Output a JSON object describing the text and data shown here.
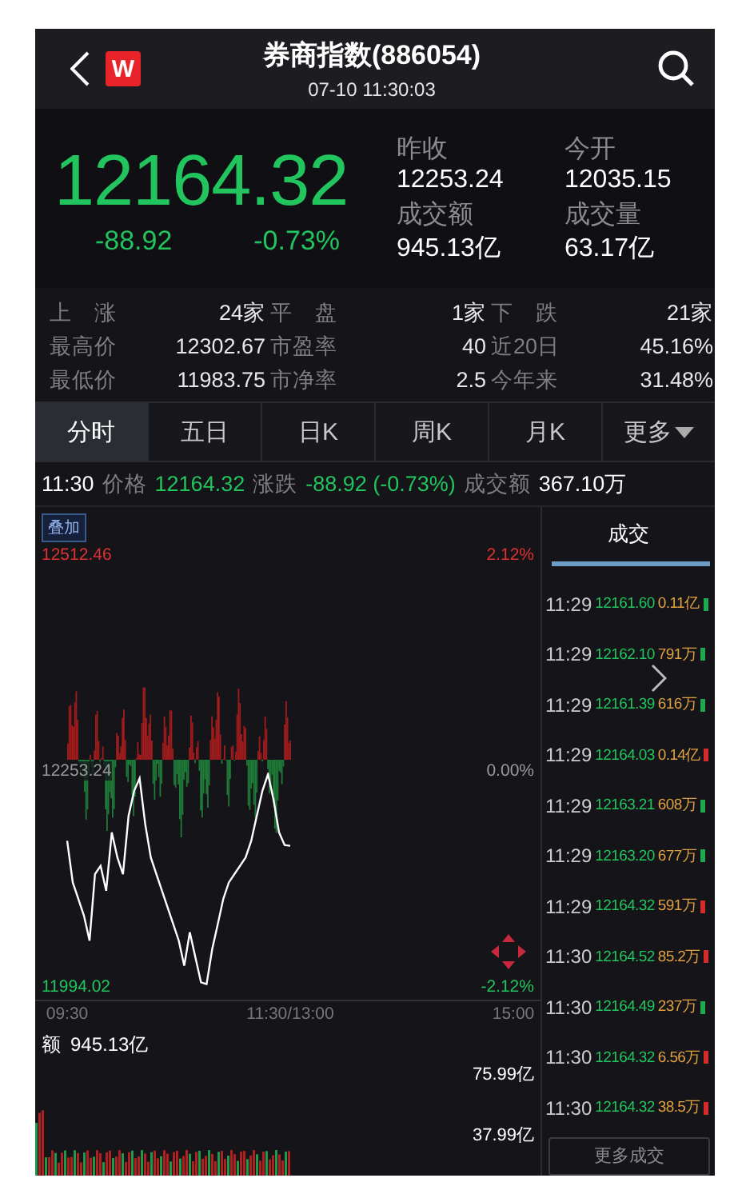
{
  "header": {
    "logo": "W",
    "title": "券商指数(886054)",
    "datetime": "07-10 11:30:03"
  },
  "quote": {
    "price": "12164.32",
    "change": "-88.92",
    "change_pct": "-0.73%",
    "fields": [
      {
        "label": "昨收",
        "value": "12253.24"
      },
      {
        "label": "今开",
        "value": "12035.15"
      },
      {
        "label": "成交额",
        "value": "945.13亿"
      },
      {
        "label": "成交量",
        "value": "63.17亿"
      }
    ]
  },
  "stats": [
    [
      {
        "label": "上　涨",
        "value": "24家"
      },
      {
        "label": "平　盘",
        "value": "1家"
      },
      {
        "label": "下　跌",
        "value": "21家"
      }
    ],
    [
      {
        "label": "最高价",
        "value": "12302.67"
      },
      {
        "label": "市盈率",
        "value": "40"
      },
      {
        "label": "近20日",
        "value": "45.16%"
      }
    ],
    [
      {
        "label": "最低价",
        "value": "11983.75"
      },
      {
        "label": "市净率",
        "value": "2.5"
      },
      {
        "label": "今年来",
        "value": "31.48%"
      }
    ]
  ],
  "tabs": [
    {
      "label": "分时",
      "selected": true
    },
    {
      "label": "五日",
      "selected": false
    },
    {
      "label": "日K",
      "selected": false
    },
    {
      "label": "周K",
      "selected": false
    },
    {
      "label": "月K",
      "selected": false
    },
    {
      "label": "更多",
      "selected": false,
      "dropdown": true
    }
  ],
  "info_line": {
    "time": "11:30",
    "price": "12164.32",
    "change_label": "涨跌",
    "change": "-88.92 (-0.73%)",
    "amount_label": "成交额",
    "amount": "367.10万"
  },
  "chart": {
    "overlay_button": "叠加",
    "high_pct": "2.12%",
    "base_pct": "0.00%",
    "low_pct": "-2.12%",
    "volume_label": "额",
    "volume_total": "945.13亿",
    "volume_max": "75.99亿",
    "volume_mid": "37.99亿",
    "chart_data": {
      "type": "line",
      "ylim": [
        11994.02,
        12512.46
      ],
      "categories": [
        "09:30",
        null,
        null,
        null,
        null,
        null,
        null,
        null,
        null,
        null,
        null,
        null,
        null,
        null,
        null,
        null,
        null,
        null,
        null,
        null,
        null,
        null,
        null,
        null,
        null,
        null,
        null,
        null,
        null,
        null,
        null,
        null,
        null,
        null,
        null,
        null,
        null,
        null,
        null,
        null,
        "11:30/13:00",
        null,
        null,
        null,
        null,
        null,
        null,
        null,
        null,
        null,
        null,
        null,
        null,
        null,
        null,
        null,
        null,
        null,
        null,
        null,
        null,
        null,
        null,
        null,
        null,
        null,
        null,
        null,
        null,
        null,
        null,
        null,
        null,
        null,
        null,
        null,
        null,
        null,
        null,
        null,
        "15:00"
      ],
      "yticks": [
        {
          "value": 12512.46,
          "label": "12512.46"
        },
        {
          "value": 12253.24,
          "label": "12253.24"
        },
        {
          "value": 11994.02,
          "label": "11994.02"
        }
      ],
      "series": [
        {
          "name": "价格",
          "color": "#ffffff",
          "values": [
            12170,
            12120,
            12100,
            12080,
            12050,
            12130,
            12140,
            12110,
            12180,
            12150,
            12130,
            12200,
            12230,
            12245,
            12190,
            12150,
            12130,
            12110,
            12090,
            12070,
            12050,
            12020,
            12060,
            12030,
            12000,
            11998,
            12040,
            12070,
            12100,
            12120,
            12130,
            12140,
            12150,
            12170,
            12200,
            12230,
            12250,
            12220,
            12180,
            12165,
            12164,
            null,
            null,
            null,
            null,
            null,
            null,
            null,
            null,
            null,
            null,
            null,
            null,
            null,
            null,
            null,
            null,
            null,
            null,
            null,
            null,
            null,
            null,
            null,
            null,
            null,
            null,
            null,
            null,
            null,
            null,
            null,
            null,
            null,
            null,
            null,
            null,
            null,
            null,
            null,
            null
          ]
        }
      ]
    }
  },
  "trades": {
    "title": "成交",
    "more_button": "更多成交",
    "rows": [
      {
        "time": "11:29",
        "price": "12161.60",
        "volume": "0.11亿",
        "color": "#1fa84f"
      },
      {
        "time": "11:29",
        "price": "12162.10",
        "volume": "791万",
        "color": "#1fa84f"
      },
      {
        "time": "11:29",
        "price": "12161.39",
        "volume": "616万",
        "color": "#1fa84f"
      },
      {
        "time": "11:29",
        "price": "12164.03",
        "volume": "0.14亿",
        "color": "#d42b2b"
      },
      {
        "time": "11:29",
        "price": "12163.21",
        "volume": "608万",
        "color": "#1fa84f"
      },
      {
        "time": "11:29",
        "price": "12163.20",
        "volume": "677万",
        "color": "#1fa84f"
      },
      {
        "time": "11:29",
        "price": "12164.32",
        "volume": "591万",
        "color": "#d42b2b"
      },
      {
        "time": "11:30",
        "price": "12164.52",
        "volume": "85.2万",
        "color": "#d42b2b"
      },
      {
        "time": "11:30",
        "price": "12164.49",
        "volume": "237万",
        "color": "#1fa84f"
      },
      {
        "time": "11:30",
        "price": "12164.32",
        "volume": "6.56万",
        "color": "#d42b2b"
      },
      {
        "time": "11:30",
        "price": "12164.32",
        "volume": "38.5万",
        "color": "#d42b2b"
      }
    ]
  }
}
